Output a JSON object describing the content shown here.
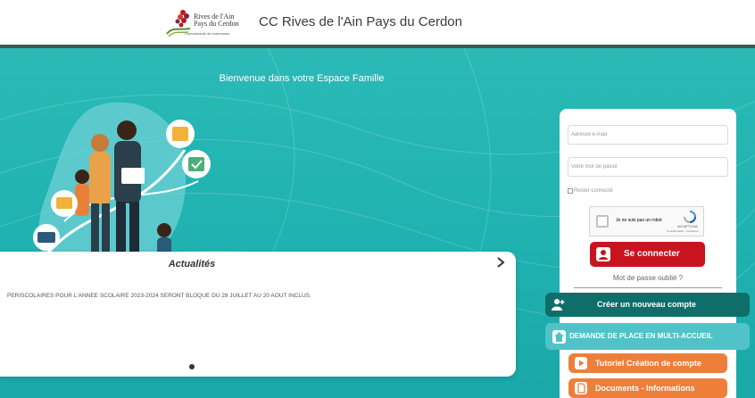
{
  "header": {
    "logo_line1": "Rives de l'Ain",
    "logo_line2": "Pays du Cerdon",
    "logo_sub": "Communauté de communes",
    "title": "CC Rives de l'Ain Pays du Cerdon"
  },
  "main": {
    "welcome": "Bienvenue dans votre Espace Famille"
  },
  "news": {
    "title": "Actualités",
    "next_icon": "chevron-right-icon",
    "text": "PERISCOLAIRES POUR L'ANNEE SCOLAIRE 2023-2024 SERONT BLOQUE DU 28 JUILLET AU 20 AOUT INCLUS."
  },
  "login": {
    "email_placeholder": "Adresse e-mail",
    "password_placeholder": "Votre mot de passe",
    "remember_label": "Rester connecté",
    "captcha_label": "Je ne suis pas un robot",
    "captcha_brand": "reCAPTCHA",
    "captcha_links": "Confidentialité - Conditions",
    "login_button": "Se connecter",
    "forgot_link": "Mot de passe oublié ?"
  },
  "actions": {
    "create_account": "Créer un nouveau compte",
    "multi_accueil": "DEMANDE DE PLACE EN MULTI-ACCUEIL",
    "tutorial": "Tutoriel Création de compte",
    "documents": "Documents - Informations"
  },
  "colors": {
    "teal": "#1fb2b0",
    "dark_teal": "#0f6e6a",
    "light_teal": "#4fc3c8",
    "login_red": "#c8141e",
    "orange": "#ee7f3b"
  }
}
